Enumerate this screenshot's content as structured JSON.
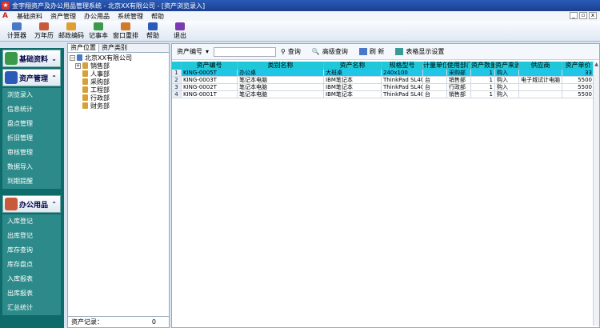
{
  "window": {
    "title": "金宇翔资产及办公用品管理系统 - 北京XX有限公司 - [资产浏览录入]"
  },
  "menubar": {
    "items": [
      "基础资料",
      "资产管理",
      "办公用品",
      "系统管理",
      "帮助"
    ]
  },
  "toolbar": {
    "buttons": [
      {
        "label": "计算器",
        "icon": "calculator-icon",
        "color": "#4a78c8"
      },
      {
        "label": "万年历",
        "icon": "calendar-icon",
        "color": "#c85a3a"
      },
      {
        "label": "邮政编码",
        "icon": "postcode-icon",
        "color": "#e0a030"
      },
      {
        "label": "记事本",
        "icon": "notepad-icon",
        "color": "#3a9a4a"
      },
      {
        "label": "窗口重排",
        "icon": "window-arrange-icon",
        "color": "#d07a2a"
      },
      {
        "label": "帮助",
        "icon": "help-icon",
        "color": "#2a5bb8"
      },
      {
        "label": "退出",
        "icon": "exit-icon",
        "color": "#7a3ab0"
      }
    ]
  },
  "nav": {
    "basic": {
      "label": "基础资料"
    },
    "asset": {
      "label": "资产管理",
      "items": [
        "浏览录入",
        "信息统计",
        "盘点管理",
        "折旧管理",
        "审核管理",
        "数据导入",
        "到期提醒"
      ]
    },
    "office": {
      "label": "办公用品",
      "items": [
        "入库登记",
        "出库登记",
        "库存查询",
        "库存盘点",
        "入库报表",
        "出库报表",
        "汇总统计"
      ]
    }
  },
  "tree": {
    "tabs": [
      "资产位置",
      "资产类别"
    ],
    "root": "北京XX有限公司",
    "nodes": [
      "销售部",
      "人事部",
      "采购部",
      "工程部",
      "行政部",
      "财务部"
    ],
    "footer_label": "资产记录：",
    "footer_count": "0"
  },
  "search": {
    "field_select": "资产编号",
    "query_label": "查询",
    "advanced_label": "高级查询",
    "refresh_label": "刷 新",
    "display_settings_label": "表格显示设置"
  },
  "grid": {
    "columns": [
      "资产编号",
      "类别名称",
      "资产名称",
      "规格型号",
      "计量单位",
      "使用部门",
      "资产数量",
      "资产来源",
      "供应商",
      "资产单价"
    ],
    "rows": [
      {
        "n": "1",
        "code": "KING-0005T",
        "category": "办公桌",
        "name": "大班桌",
        "spec": "240x100",
        "unit": "",
        "dept": "采购部",
        "qty": "1",
        "source": "购入",
        "supplier": "",
        "price": "33"
      },
      {
        "n": "2",
        "code": "KING-0003T",
        "category": "笔记本电脑",
        "name": "IBM笔记本",
        "spec": "ThinkPad SL400",
        "unit": "台",
        "dept": "销售部",
        "qty": "1",
        "source": "购入",
        "supplier": "电子城试计电脑",
        "price": "5500"
      },
      {
        "n": "3",
        "code": "KING-0002T",
        "category": "笔记本电脑",
        "name": "IBM笔记本",
        "spec": "ThinkPad SL400",
        "unit": "台",
        "dept": "行政部",
        "qty": "1",
        "source": "购入",
        "supplier": "",
        "price": "5500"
      },
      {
        "n": "4",
        "code": "KING-0001T",
        "category": "笔记本电脑",
        "name": "IBM笔记本",
        "spec": "ThinkPad SL400",
        "unit": "台",
        "dept": "销售部",
        "qty": "1",
        "source": "购入",
        "supplier": "",
        "price": "5500"
      }
    ]
  },
  "colors": {
    "header_cyan": "#1ec8d8",
    "selected_row": "#20c6e8",
    "nav_teal": "#0f6a6a"
  }
}
